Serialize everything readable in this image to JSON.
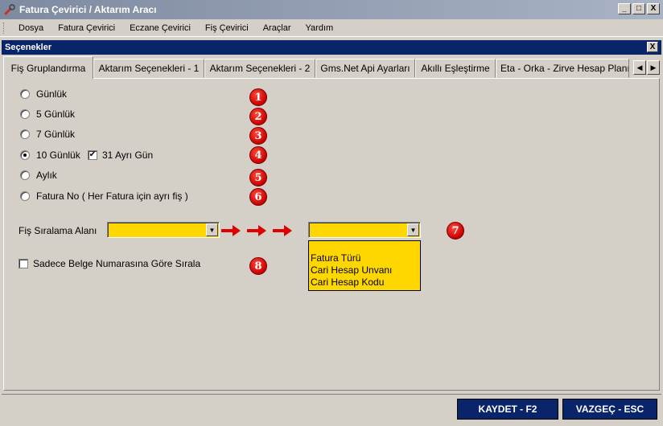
{
  "window": {
    "title": "Fatura Çevirici / Aktarım Aracı",
    "controls": [
      "_",
      "□",
      "X"
    ]
  },
  "menu": [
    "Dosya",
    "Fatura Çevirici",
    "Eczane Çevirici",
    "Fiş Çevirici",
    "Araçlar",
    "Yardım"
  ],
  "dialog": {
    "title": "Seçenekler",
    "close": "X"
  },
  "tabs": [
    {
      "label": "Fiş Gruplandırma",
      "active": true
    },
    {
      "label": "Aktarım Seçenekleri - 1",
      "active": false
    },
    {
      "label": "Aktarım Seçenekleri - 2",
      "active": false
    },
    {
      "label": "Gms.Net Api Ayarları",
      "active": false
    },
    {
      "label": "Akıllı Eşleştirme",
      "active": false
    },
    {
      "label": "Eta - Orka - Zirve Hesap Planı",
      "active": false
    }
  ],
  "grouping": {
    "options": [
      {
        "label": "Günlük",
        "checked": false,
        "badge": "1"
      },
      {
        "label": "5 Günlük",
        "checked": false,
        "badge": "2"
      },
      {
        "label": "7 Günlük",
        "checked": false,
        "badge": "3"
      },
      {
        "label": "10 Günlük",
        "checked": true,
        "badge": "4"
      },
      {
        "label": "Aylık",
        "checked": false,
        "badge": "5"
      },
      {
        "label": "Fatura No  ( Her Fatura için ayrı fiş )",
        "checked": false,
        "badge": "6"
      }
    ],
    "separate_31": {
      "label": "31 Ayrı Gün",
      "checked": true
    }
  },
  "sort": {
    "label": "Fiş Sıralama Alanı",
    "first_value": "",
    "second_value": "",
    "badge": "7",
    "options": [
      "Fatura Türü",
      "Cari Hesap Unvanı",
      "Cari Hesap Kodu"
    ]
  },
  "doc_number_sort": {
    "label": "Sadece Belge Numarasına Göre Sırala",
    "checked": false,
    "badge": "8"
  },
  "buttons": {
    "save": "KAYDET - F2",
    "cancel": "VAZGEÇ - ESC"
  },
  "colors": {
    "combo_bg": "#ffd700",
    "arrow": "#e00000",
    "button_bg": "#0a246a"
  }
}
